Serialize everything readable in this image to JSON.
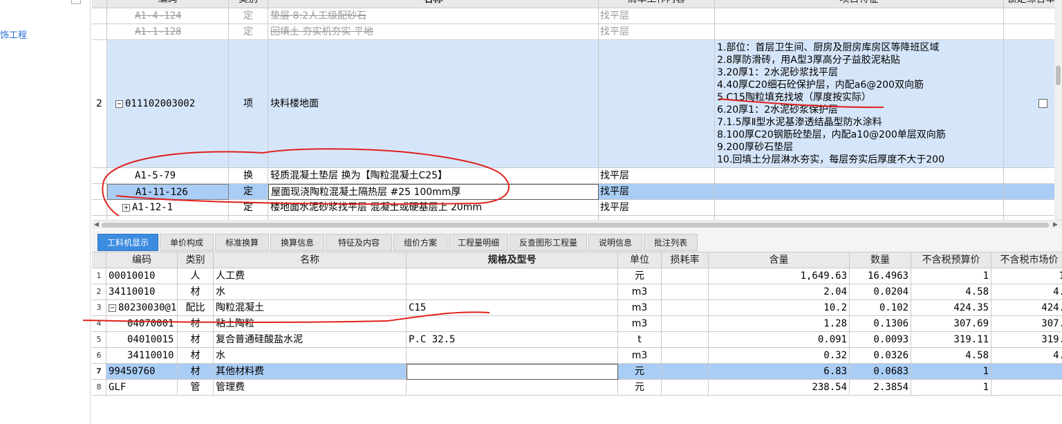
{
  "left_panel": {
    "tree_item": "饰工程"
  },
  "upper": {
    "headers": {
      "code": "编码",
      "category": "类别",
      "name": "名称",
      "work_content": "清单工作内容",
      "feature": "项目特征",
      "last": "锁定综合单"
    },
    "rows": [
      {
        "num": "",
        "code": "A1-4-124",
        "category": "定",
        "name": "垫层 8:2人工级配砂石",
        "work": "找平层",
        "struck": true
      },
      {
        "num": "",
        "code": "A1-1-128",
        "category": "定",
        "name": "回填土 夯实机夯实 平地",
        "work": "找平层",
        "struck": true
      },
      {
        "num": "2",
        "code": "011102003002",
        "category": "项",
        "name": "块料楼地面",
        "work": "",
        "struck": false
      },
      {
        "num": "",
        "code": "A1-5-79",
        "category": "换",
        "name": "轻质混凝土垫层  换为【陶粒混凝土C25】",
        "work": "找平层",
        "struck": false
      },
      {
        "num": "",
        "code": "A1-11-126",
        "category": "定",
        "name": "屋面现浇陶粒混凝土隔热层 #25 100mm厚",
        "work": "找平层",
        "struck": false
      },
      {
        "num": "",
        "code": "A1-12-1",
        "category": "定",
        "name": "楼地面水泥砂浆找平层 混凝土或硬基层上 20mm",
        "work": "找平层",
        "struck": false
      }
    ],
    "features": [
      "1.部位：首层卫生间、厨房及厨房库房区等降班区域",
      "2.8厚防滑砖，用A型3厚高分子益胶泥粘贴",
      "3.20厚1：2水泥砂浆找平层",
      "4.40厚C20细石砼保护层，内配a6@200双向筋",
      "5.C15陶粒填充找坡（厚度按实际）",
      "6.20厚1：2水泥砂浆保护层",
      "7.1.5厚Ⅱ型水泥基渗透结晶型防水涂料",
      "8.100厚C20钢筋砼垫层，内配a10@200单层双向筋",
      "9.200厚砂石垫层",
      "10.回填土分层淋水夯实，每层夯实后厚度不大于200"
    ]
  },
  "tabs": [
    "工料机显示",
    "单价构成",
    "标准换算",
    "换算信息",
    "特征及内容",
    "组价方案",
    "工程量明细",
    "反查图形工程量",
    "说明信息",
    "批注列表"
  ],
  "lower": {
    "headers": {
      "code": "编码",
      "category": "类别",
      "name": "名称",
      "spec": "规格及型号",
      "unit": "单位",
      "loss": "损耗率",
      "content": "含量",
      "qty": "数量",
      "budget_price": "不含税预算价",
      "market_price": "不含税市场价"
    },
    "rows": [
      {
        "n": "1",
        "code": "00010010",
        "cat": "人",
        "name": "人工费",
        "spec": "",
        "unit": "元",
        "loss": "",
        "content": "1,649.63",
        "qty": "16.4963",
        "budget": "1",
        "market": "1"
      },
      {
        "n": "2",
        "code": "34110010",
        "cat": "材",
        "name": "水",
        "spec": "",
        "unit": "m3",
        "loss": "",
        "content": "2.04",
        "qty": "0.0204",
        "budget": "4.58",
        "market": "4."
      },
      {
        "n": "3",
        "code": "80230030@1",
        "cat": "配比",
        "name": "陶粒混凝土",
        "spec": "C15",
        "unit": "m3",
        "loss": "",
        "content": "10.2",
        "qty": "0.102",
        "budget": "424.35",
        "market": "424."
      },
      {
        "n": "4",
        "code": "04070001",
        "cat": "材",
        "name": "粘土陶粒",
        "spec": "",
        "unit": "m3",
        "loss": "",
        "content": "1.28",
        "qty": "0.1306",
        "budget": "307.69",
        "market": "307."
      },
      {
        "n": "5",
        "code": "04010015",
        "cat": "材",
        "name": "复合普通硅酸盐水泥",
        "spec": "P.C 32.5",
        "unit": "t",
        "loss": "",
        "content": "0.091",
        "qty": "0.0093",
        "budget": "319.11",
        "market": "319."
      },
      {
        "n": "6",
        "code": "34110010",
        "cat": "材",
        "name": "水",
        "spec": "",
        "unit": "m3",
        "loss": "",
        "content": "0.32",
        "qty": "0.0326",
        "budget": "4.58",
        "market": "4."
      },
      {
        "n": "7",
        "code": "99450760",
        "cat": "材",
        "name": "其他材料费",
        "spec": "",
        "unit": "元",
        "loss": "",
        "content": "6.83",
        "qty": "0.0683",
        "budget": "1",
        "market": ""
      },
      {
        "n": "8",
        "code": "GLF",
        "cat": "管",
        "name": "管理费",
        "spec": "",
        "unit": "元",
        "loss": "",
        "content": "238.54",
        "qty": "2.3854",
        "budget": "1",
        "market": ""
      }
    ]
  }
}
